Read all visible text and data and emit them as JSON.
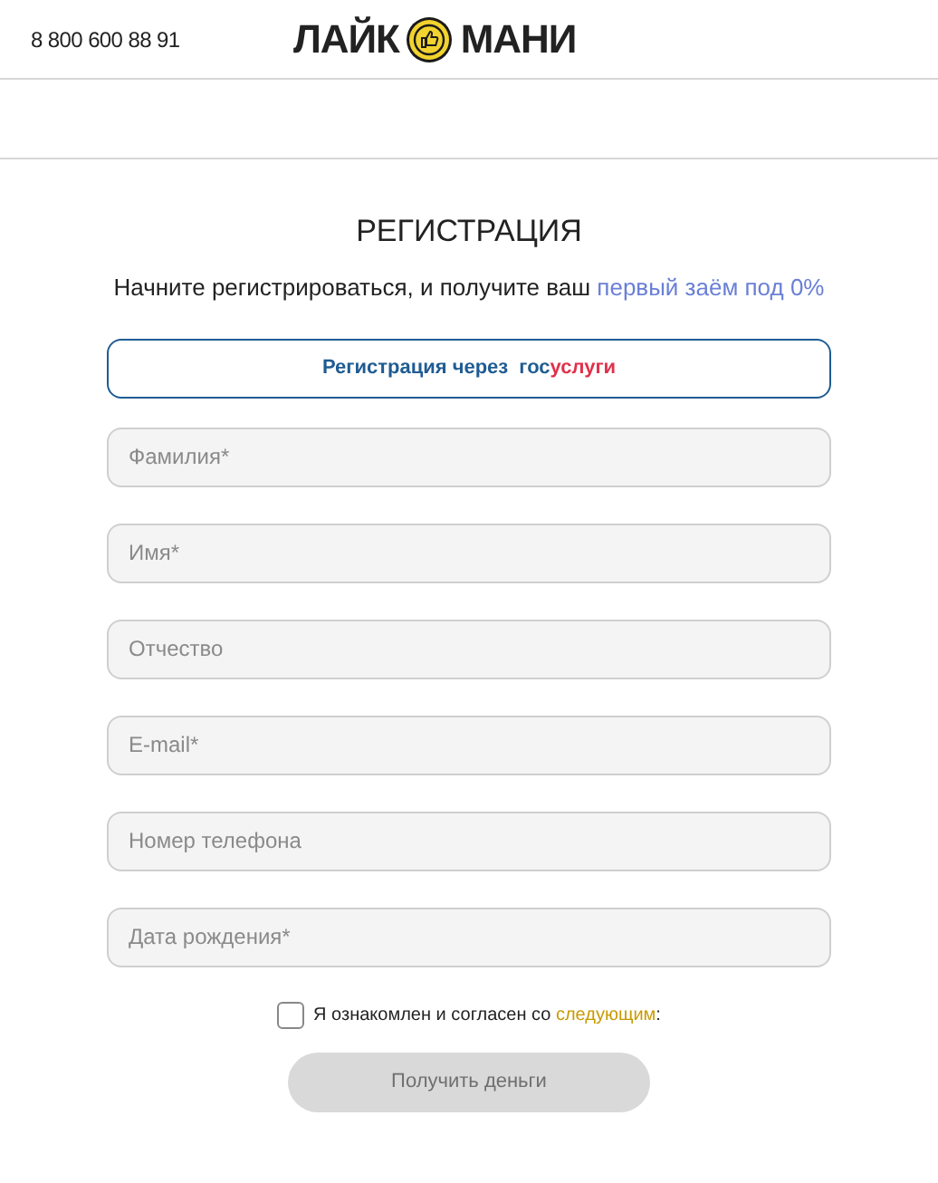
{
  "header": {
    "phone": "8 800 600 88 91",
    "logo_left": "ЛАЙК",
    "logo_right": "МАНИ"
  },
  "title": "РЕГИСТРАЦИЯ",
  "subtitle": {
    "text": "Начните регистрироваться, и получите ваш ",
    "link": "первый заём под 0%"
  },
  "gosuslugi_button": {
    "label": "Регистрация через",
    "brand_first": "гос",
    "brand_second": "услуги"
  },
  "fields": [
    {
      "placeholder": "Фамилия*"
    },
    {
      "placeholder": "Имя*"
    },
    {
      "placeholder": "Отчество"
    },
    {
      "placeholder": "E-mail*"
    },
    {
      "placeholder": "Номер телефона"
    },
    {
      "placeholder": "Дата рождения*"
    }
  ],
  "agreement": {
    "checked": false,
    "text": "Я ознакомлен и согласен со ",
    "link": "следующим",
    "suffix": ":"
  },
  "submit": {
    "label": "Получить деньги",
    "disabled": true
  }
}
